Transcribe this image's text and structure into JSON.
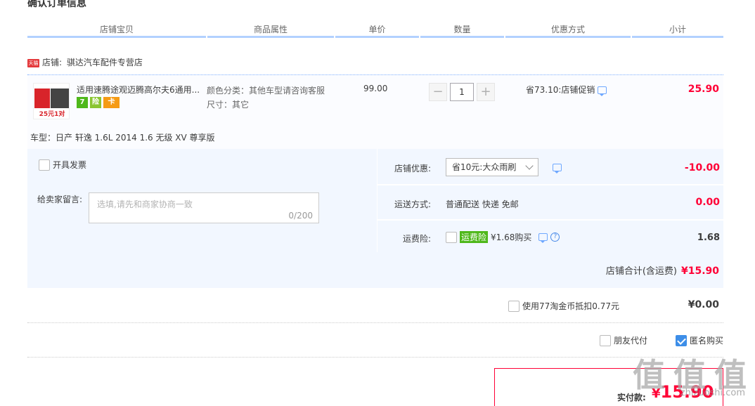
{
  "section_title": "确认订单信息",
  "table_headers": [
    "店铺宝贝",
    "商品属性",
    "单价",
    "数量",
    "优惠方式",
    "小计"
  ],
  "shop": {
    "badge": "天猫",
    "label": "店铺:",
    "name": "骐达汽车配件专营店"
  },
  "product": {
    "thumb_banner": "25元1对",
    "title": "适用速腾途观迈腾高尔夫6通用...",
    "service_icons": [
      "7",
      "险",
      "卡"
    ],
    "attr_color": "颜色分类：其他车型请咨询客服",
    "attr_size": "尺寸：其它",
    "unit_price": "99.00",
    "qty_minus": "−",
    "quantity": "1",
    "qty_plus": "+",
    "promo": "省73.10:店铺促销",
    "subtotal": "25.90",
    "car_type": "车型：日产 轩逸 1.6L 2014 1.6 无级 XV 尊享版"
  },
  "invoice_label": "开具发票",
  "message": {
    "label": "给卖家留言:",
    "placeholder": "选填,请先和商家协商一致",
    "count": "0/200"
  },
  "shop_discount": {
    "label": "店铺优惠:",
    "selected": "省10元:大众雨刷",
    "value": "-10.00"
  },
  "shipping": {
    "label": "运送方式:",
    "method": "普通配送 快递 免邮",
    "value": "0.00"
  },
  "insurance": {
    "label": "运费险:",
    "tag": "运费险",
    "price": "¥1.68购买",
    "value": "1.68"
  },
  "shop_total": {
    "label": "店铺合计(含运费)",
    "value": "¥15.90"
  },
  "coins": {
    "label": "使用77淘金币抵扣0.77元",
    "value": "¥0.00"
  },
  "friend_pay": "朋友代付",
  "anonymous": "匿名购买",
  "final": {
    "label": "实付款:",
    "yen": "¥",
    "value": "15.90"
  },
  "watermark": "值 值 值",
  "watermark_sub": "zhizuoshi.com",
  "colors": {
    "accent_red": "#ff0036",
    "header_line": "#b2d1ff",
    "panel_bg": "#f2f7ff",
    "insurance_green": "#4fb81b"
  }
}
